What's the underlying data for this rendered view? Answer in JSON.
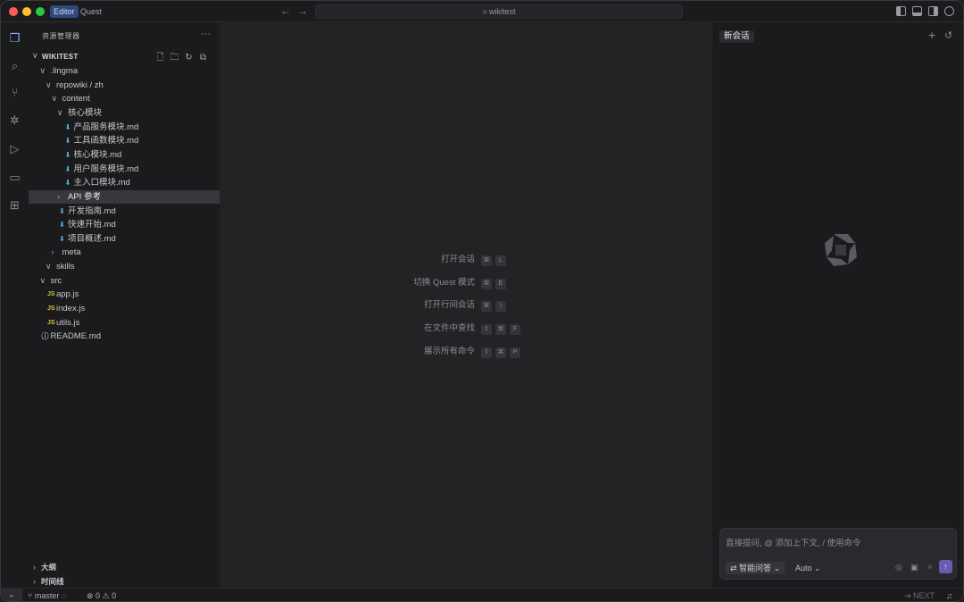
{
  "titlebar": {
    "tabs": [
      {
        "label": "Editor",
        "active": true
      },
      {
        "label": "Quest",
        "active": false
      }
    ],
    "search": "wikitest"
  },
  "sidebar": {
    "title": "资源管理器",
    "more": "···",
    "project": "WIKITEST",
    "tree": [
      {
        "label": ".lingma",
        "type": "folder",
        "depth": 1
      },
      {
        "label": "repowiki / zh",
        "type": "folder",
        "depth": 2
      },
      {
        "label": "content",
        "type": "folder",
        "depth": 3
      },
      {
        "label": "核心模块",
        "type": "folder",
        "depth": 4
      },
      {
        "label": "产品服务模块.md",
        "type": "md",
        "depth": 5
      },
      {
        "label": "工具函数模块.md",
        "type": "md",
        "depth": 5
      },
      {
        "label": "核心模块.md",
        "type": "md",
        "depth": 5
      },
      {
        "label": "用户服务模块.md",
        "type": "md",
        "depth": 5
      },
      {
        "label": "主入口模块.md",
        "type": "md",
        "depth": 5
      },
      {
        "label": "API 参考",
        "type": "folder-collapsed",
        "depth": 4,
        "selected": true
      },
      {
        "label": "开发指南.md",
        "type": "md",
        "depth": 4
      },
      {
        "label": "快速开始.md",
        "type": "md",
        "depth": 4
      },
      {
        "label": "项目概述.md",
        "type": "md",
        "depth": 4
      },
      {
        "label": "meta",
        "type": "folder-collapsed",
        "depth": 3
      },
      {
        "label": "skills",
        "type": "folder",
        "depth": 2
      },
      {
        "label": "src",
        "type": "folder",
        "depth": 1
      },
      {
        "label": "app.js",
        "type": "js",
        "depth": 2
      },
      {
        "label": "index.js",
        "type": "js",
        "depth": 2
      },
      {
        "label": "utils.js",
        "type": "js",
        "depth": 2
      },
      {
        "label": "README.md",
        "type": "info",
        "depth": 1
      }
    ],
    "bottom": [
      {
        "label": "大纲"
      },
      {
        "label": "时间线"
      }
    ]
  },
  "editor": {
    "shortcuts": [
      {
        "label": "打开会话",
        "keys": [
          "⌘",
          "L"
        ]
      },
      {
        "label": "切换 Quest 模式",
        "keys": [
          "⌘",
          "E"
        ]
      },
      {
        "label": "打开行间会话",
        "keys": [
          "⌘",
          "I"
        ]
      },
      {
        "label": "在文件中查找",
        "keys": [
          "⇧",
          "⌘",
          "F"
        ]
      },
      {
        "label": "展示所有命令",
        "keys": [
          "⇧",
          "⌘",
          "P"
        ]
      }
    ]
  },
  "chat": {
    "tab": "新会话",
    "placeholder": "直接提问, @ 添加上下文, / 使用命令",
    "mode": "智能问答",
    "model": "Auto"
  },
  "statusbar": {
    "branch": "master",
    "errors": "0",
    "warnings": "0",
    "next": "NEXT"
  }
}
